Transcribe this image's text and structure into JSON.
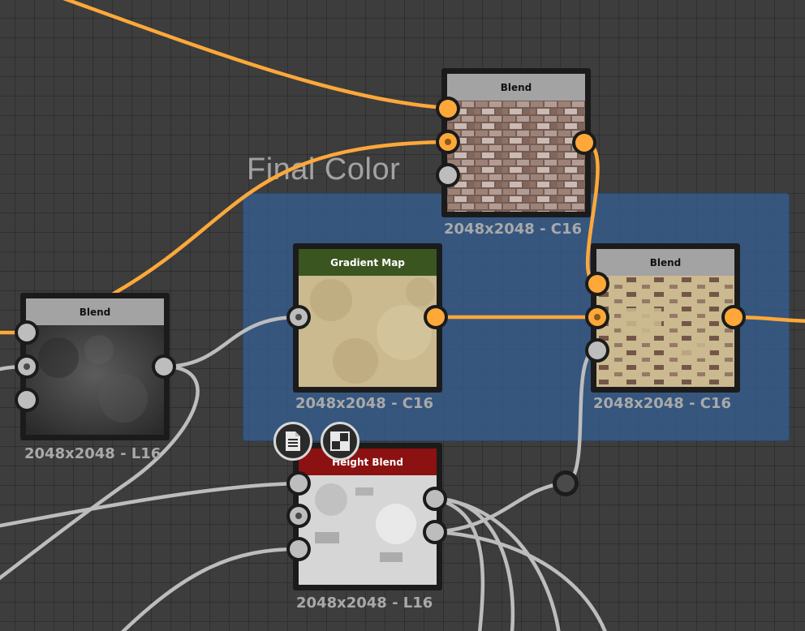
{
  "frame": {
    "title": "Final Color"
  },
  "nodes": {
    "blend_top": {
      "title": "Blend",
      "resolution": "2048x2048 - C16"
    },
    "blend_left": {
      "title": "Blend",
      "resolution": "2048x2048 - L16"
    },
    "gradient_map": {
      "title": "Gradient Map",
      "resolution": "2048x2048 - C16"
    },
    "blend_right": {
      "title": "Blend",
      "resolution": "2048x2048 - C16"
    },
    "height_blend": {
      "title": "Height Blend",
      "resolution": "2048x2048 - L16"
    }
  },
  "icons": {
    "document": "document-icon",
    "checker": "checker-icon"
  },
  "colors": {
    "canvas_bg": "#3d3d3d",
    "frame_bg": "#345c8c",
    "wire_color": "#ffa83a",
    "wire_gray": "#bdbdbd",
    "node_bg": "#1b1b1b",
    "header_gray": "#a3a3a3",
    "header_green": "#3b5520",
    "header_red": "#8c1111"
  }
}
